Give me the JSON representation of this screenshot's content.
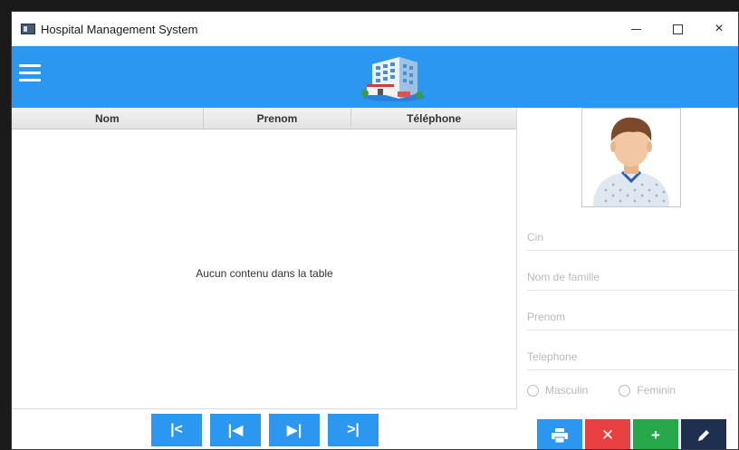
{
  "window": {
    "title": "Hospital Management System",
    "icon": "window-app-icon",
    "controls": {
      "minimize": "minimize-icon",
      "maximize": "maximize-icon",
      "close": "×"
    }
  },
  "header": {
    "bg_color": "#2c97f0",
    "menu_icon": "hamburger-menu-icon",
    "logo": "hospital-building-icon"
  },
  "table": {
    "columns": [
      "Nom",
      "Prenom",
      "Téléphone"
    ],
    "empty_message": "Aucun contenu dans la table"
  },
  "form": {
    "avatar": "patient-avatar-icon",
    "fields": [
      {
        "placeholder": "Cin",
        "value": ""
      },
      {
        "placeholder": "Nom de famille",
        "value": ""
      },
      {
        "placeholder": "Prenom",
        "value": ""
      },
      {
        "placeholder": "Telephone",
        "value": ""
      }
    ],
    "gender_options": [
      "Masculin",
      "Feminin"
    ]
  },
  "navigation": {
    "buttons": [
      {
        "name": "first-record-button",
        "label": "|<",
        "icon": "skip-first-icon"
      },
      {
        "name": "previous-record-button",
        "label": "|◀",
        "icon": "previous-icon"
      },
      {
        "name": "next-record-button",
        "label": "▶|",
        "icon": "next-icon"
      },
      {
        "name": "last-record-button",
        "label": ">|",
        "icon": "skip-last-icon"
      }
    ],
    "color": "#2c97f0"
  },
  "actions": {
    "print": {
      "icon": "print-icon",
      "color": "#2c97f0"
    },
    "delete": {
      "label": "✕",
      "icon": "delete-icon",
      "color": "#e84040"
    },
    "add": {
      "label": "+",
      "icon": "add-icon",
      "color": "#27a84a"
    },
    "edit": {
      "icon": "edit-pencil-icon",
      "color": "#1f2f4f"
    }
  }
}
